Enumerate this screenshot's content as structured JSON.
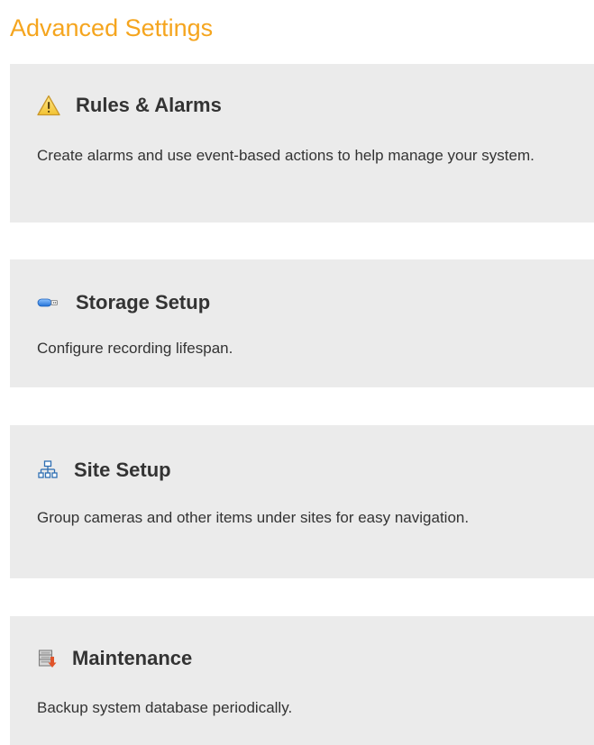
{
  "page": {
    "title": "Advanced Settings"
  },
  "colors": {
    "title_accent": "#f5a51e",
    "card_background": "#ebebeb",
    "text": "#333333"
  },
  "cards": [
    {
      "icon": "warning-icon",
      "title": "Rules & Alarms",
      "description": "Create alarms and use event-based actions to help manage your system."
    },
    {
      "icon": "storage-drive-icon",
      "title": "Storage Setup",
      "description": "Configure recording lifespan."
    },
    {
      "icon": "site-hierarchy-icon",
      "title": "Site Setup",
      "description": "Group cameras and other items under sites for easy navigation."
    },
    {
      "icon": "database-backup-icon",
      "title": "Maintenance",
      "description": "Backup system database periodically."
    }
  ]
}
